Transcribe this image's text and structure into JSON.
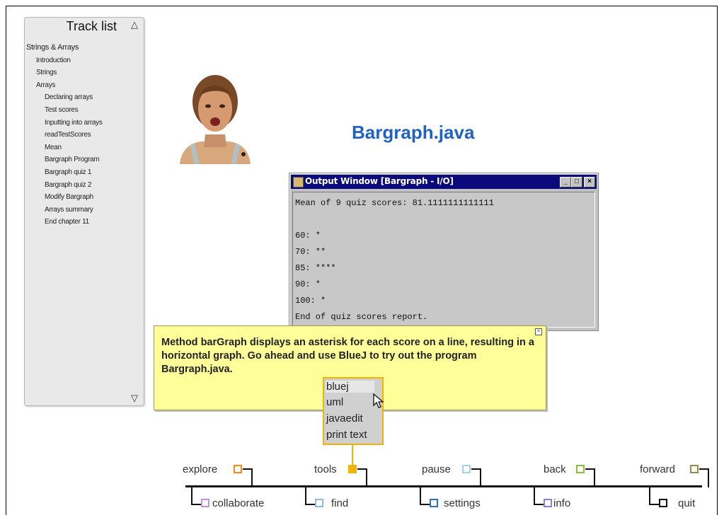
{
  "tracklist": {
    "title": "Track list",
    "up_icon": "up-triangle-icon",
    "down_icon": "down-triangle-icon",
    "items": [
      {
        "label": "Strings & Arrays",
        "level": 0
      },
      {
        "label": "Introduction",
        "level": 1
      },
      {
        "label": "Strings",
        "level": 1
      },
      {
        "label": "Arrays",
        "level": 1
      },
      {
        "label": "Declaring arrays",
        "level": 2
      },
      {
        "label": "Test scores",
        "level": 2
      },
      {
        "label": "Inputting into arrays",
        "level": 2
      },
      {
        "label": "readTestScores",
        "level": 2
      },
      {
        "label": "Mean",
        "level": 2
      },
      {
        "label": "Bargraph Program",
        "level": 2
      },
      {
        "label": "Bargraph quiz 1",
        "level": 2
      },
      {
        "label": "Bargraph quiz 2",
        "level": 2
      },
      {
        "label": "Modify Bargraph",
        "level": 2
      },
      {
        "label": "Arrays summary",
        "level": 2
      },
      {
        "label": "End chapter 11",
        "level": 2
      }
    ]
  },
  "slide": {
    "title": "Bargraph.java"
  },
  "output_window": {
    "title": "Output Window [Bargraph - I/O]",
    "buttons": {
      "minimize": "_",
      "maximize": "□",
      "close": "×"
    },
    "lines": [
      "Mean of 9 quiz scores: 81.1111111111111",
      "",
      "60: *",
      "70: **",
      "85: ****",
      "90: *",
      "100: *",
      "End of quiz scores report."
    ]
  },
  "note": {
    "text": "Method barGraph displays an asterisk for each score on a line, resulting in a horizontal graph. Go ahead and use BlueJ to try out the program Bargraph.java.",
    "close_label": "×"
  },
  "tools_menu": {
    "items": [
      "bluej",
      "uml",
      "javaedit",
      "print text"
    ],
    "highlighted": "bluej"
  },
  "nav": {
    "top": [
      {
        "label": "explore",
        "color": "#f08a1c"
      },
      {
        "label": "tools",
        "color": "#f2b400",
        "filled": true
      },
      {
        "label": "pause",
        "color": "#9ed4e8"
      },
      {
        "label": "back",
        "color": "#88c43a"
      },
      {
        "label": "forward",
        "color": "#9a8a4a"
      }
    ],
    "bottom": [
      {
        "label": "collaborate",
        "color": "#c690e0"
      },
      {
        "label": "find",
        "color": "#8ab8e8"
      },
      {
        "label": "settings",
        "color": "#2f6fd0"
      },
      {
        "label": "info",
        "color": "#8a80d8"
      },
      {
        "label": "quit",
        "color": "#111111"
      }
    ]
  }
}
